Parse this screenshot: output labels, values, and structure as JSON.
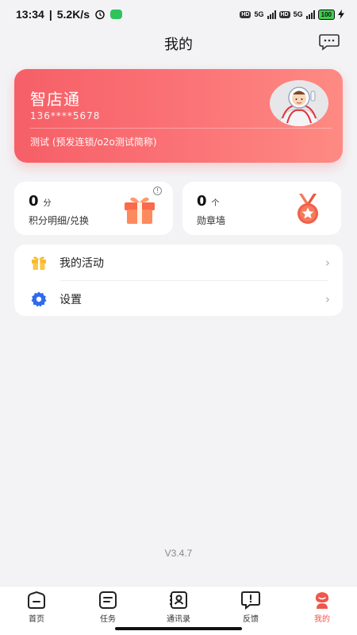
{
  "status_bar": {
    "time": "13:34",
    "speed": "5.2K/s",
    "network_1": "5G",
    "network_2": "5G",
    "hd": "HD",
    "battery": "100"
  },
  "header": {
    "title": "我的"
  },
  "profile": {
    "store_name": "智店通",
    "phone": "136****5678",
    "description": "测试 (预发连锁/o2o测试简称)"
  },
  "stats": {
    "points": {
      "value": "0",
      "unit": "分",
      "label": "积分明细/兑换"
    },
    "medals": {
      "value": "0",
      "unit": "个",
      "label": "勋章墙"
    }
  },
  "menu": [
    {
      "label": "我的活动",
      "icon": "gift-icon"
    },
    {
      "label": "设置",
      "icon": "gear-icon"
    }
  ],
  "version": "V3.4.7",
  "tabs": [
    {
      "label": "首页",
      "icon": "home-icon"
    },
    {
      "label": "任务",
      "icon": "task-icon"
    },
    {
      "label": "通讯录",
      "icon": "contacts-icon"
    },
    {
      "label": "反馈",
      "icon": "feedback-icon"
    },
    {
      "label": "我的",
      "icon": "profile-icon",
      "active": true
    }
  ],
  "colors": {
    "accent": "#f0564a",
    "card_gradient_start": "#f65f67",
    "card_gradient_end": "#fe8a83",
    "settings_blue": "#2f6bf0",
    "gift_yellow": "#f7b92f"
  }
}
